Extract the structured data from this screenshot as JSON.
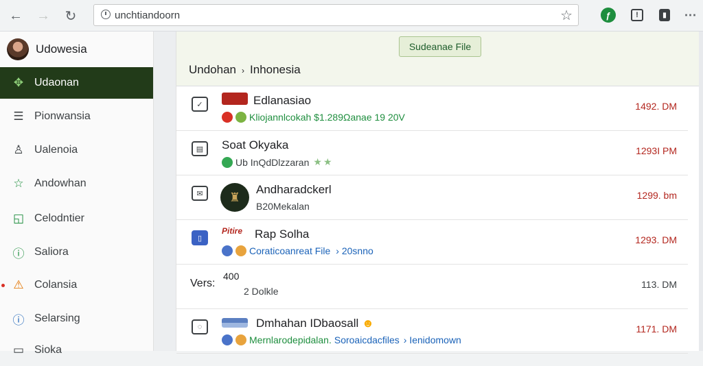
{
  "browser": {
    "url": "unchtiandoorn"
  },
  "sidebar": {
    "profile_name": "Udowesia",
    "items": [
      {
        "label": "Udaonan",
        "icon": "puzzle-icon"
      },
      {
        "label": "Pionwansia",
        "icon": "document-list-icon"
      },
      {
        "label": "Ualenoia",
        "icon": "person-icon"
      },
      {
        "label": "Andowhan",
        "icon": "star-icon"
      },
      {
        "label": "Celodntier",
        "icon": "chart-icon"
      },
      {
        "label": "Saliora",
        "icon": "info-circle-icon"
      },
      {
        "label": "Colansia",
        "icon": "warning-icon"
      },
      {
        "label": "Selarsing",
        "icon": "info-circle-icon"
      },
      {
        "label": "Sioka",
        "icon": "folder-icon"
      }
    ]
  },
  "header": {
    "primary_button": "Sudeanae File",
    "breadcrumb_root": "Undohan",
    "breadcrumb_sep": "›",
    "breadcrumb_current": "Inhonesia"
  },
  "rows": [
    {
      "title": "Edlanasiao",
      "subtitle": "Kliojannlcokah $1.289Ωanae 19 20V",
      "time": "1492. DM"
    },
    {
      "title": "Soat Okyaka",
      "subtitle": "Ub InQdDlzzaran",
      "time": "1293I PM"
    },
    {
      "title": "Andharadckerl",
      "subtitle": "B20Mekalan",
      "time": "1299. bm"
    },
    {
      "title": "Rap Solha",
      "thumb_text": "Pitire",
      "subtitle": "Coraticoanreat File",
      "subtitle_extra": "› 20snno",
      "time": "1293. DM"
    },
    {
      "lead": "Vers:",
      "title": "400",
      "subtitle": "2  Dolkle",
      "time": "113. DM"
    },
    {
      "title": "Dmhahan IDbaosall",
      "subtitle": "Mernlarodepidalan.",
      "subtitle_extra": "Soroaicdacfiles",
      "subtitle_more": "› Ienidomown",
      "time": "1171. DM"
    }
  ]
}
